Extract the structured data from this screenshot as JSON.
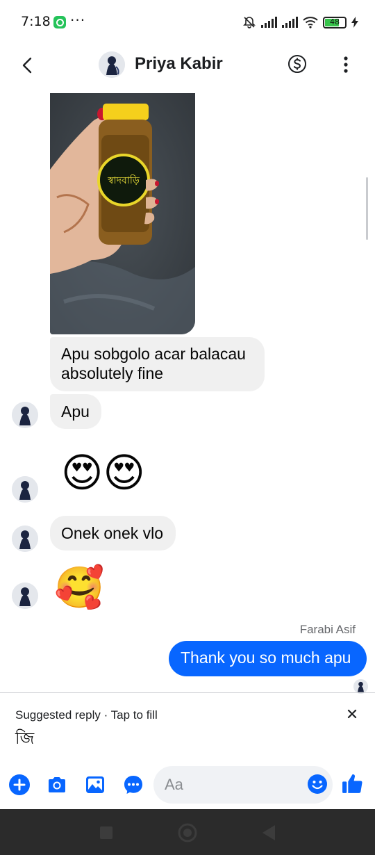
{
  "status_bar": {
    "time": "7:18",
    "battery": "48",
    "icons": [
      "whatsapp-icon",
      "more-dots",
      "mute-bell-icon",
      "signal-icon",
      "signal-icon",
      "wifi-icon",
      "battery-icon",
      "charging-icon"
    ]
  },
  "header": {
    "contact_name": "Priya Kabir",
    "back_icon": "chevron-left-icon",
    "money_icon": "dollar-circle-icon",
    "more_icon": "vertical-dots-icon"
  },
  "messages": [
    {
      "type": "image",
      "from": "contact",
      "alt": "pickle-jar-photo"
    },
    {
      "type": "text",
      "from": "contact",
      "text_lines": [
        "Apu sobgolo acar balacau",
        "absolutely fine"
      ]
    },
    {
      "type": "text",
      "from": "contact",
      "text": "Apu"
    },
    {
      "type": "emoji",
      "from": "contact",
      "text": "😍😍"
    },
    {
      "type": "text",
      "from": "contact",
      "text": "Onek onek vlo"
    },
    {
      "type": "emoji",
      "from": "contact",
      "text": "🥰"
    },
    {
      "type": "text",
      "from": "me",
      "sender_label": "Farabi Asif",
      "text": "Thank you so much apu"
    }
  ],
  "suggestion": {
    "title": "Suggested reply · Tap to fill",
    "reply": "জি"
  },
  "composer": {
    "placeholder": "Aa",
    "icons": [
      "plus-icon",
      "camera-icon",
      "gallery-icon",
      "chat-bubble-icon",
      "emoji-icon",
      "thumbs-up-icon"
    ]
  },
  "colors": {
    "accent": "#0866ff",
    "incoming_bubble": "#f0f0f0",
    "nav_bar": "#2b2b2b"
  }
}
